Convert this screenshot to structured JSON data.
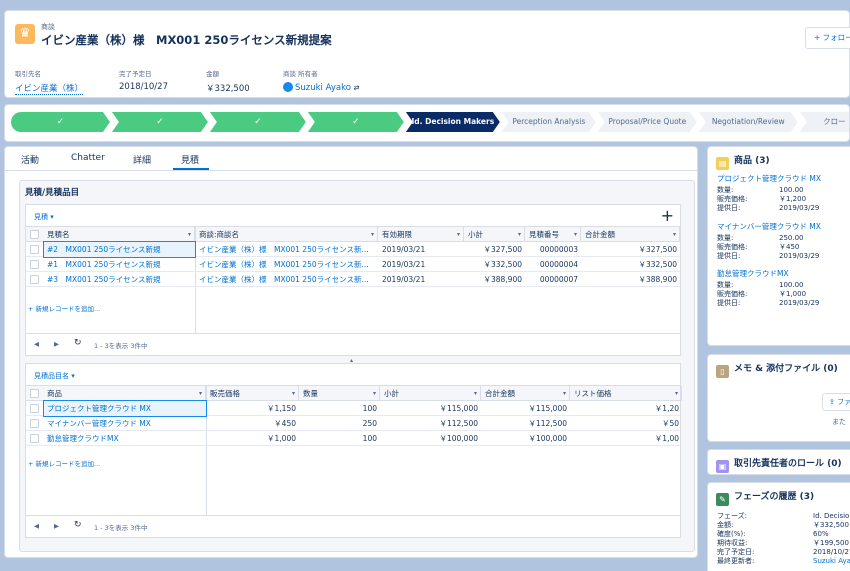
{
  "header": {
    "object_label": "商談",
    "title": "イビン産業（株）様　MX001 250ライセンス新規提案",
    "follow_label": "+ フォロー",
    "fields": [
      {
        "label": "取引先名",
        "value": "イビン産業（株）"
      },
      {
        "label": "完了予定日",
        "value": "2018/10/27"
      },
      {
        "label": "金額",
        "value": "￥332,500"
      },
      {
        "label": "商談 所有者",
        "value": "Suzuki Ayako"
      }
    ]
  },
  "path": {
    "stages": [
      {
        "label": "✓",
        "state": "done"
      },
      {
        "label": "✓",
        "state": "done"
      },
      {
        "label": "✓",
        "state": "done"
      },
      {
        "label": "✓",
        "state": "done"
      },
      {
        "label": "Id. Decision Makers",
        "state": "current"
      },
      {
        "label": "Perception Analysis",
        "state": "todo"
      },
      {
        "label": "Proposal/Price Quote",
        "state": "todo"
      },
      {
        "label": "Negotiation/Review",
        "state": "todo"
      },
      {
        "label": "クロー",
        "state": "todo"
      }
    ]
  },
  "tabs": [
    "活動",
    "Chatter",
    "詳細",
    "見積"
  ],
  "section_title": "見積/見積品目",
  "quotes_grid": {
    "view_label": "見積",
    "columns": [
      "見積名",
      "商談:商談名",
      "有効期限",
      "小計",
      "見積番号",
      "合計金額"
    ],
    "rows": [
      [
        "#2　MX001 250ライセンス新規",
        "イビン産業（株）様　MX001 250ライセンス新...",
        "2019/03/21",
        "￥327,500",
        "00000003",
        "￥327,500"
      ],
      [
        "#1　MX001 250ライセンス新規",
        "イビン産業（株）様　MX001 250ライセンス新...",
        "2019/03/21",
        "￥332,500",
        "00000004",
        "￥332,500"
      ],
      [
        "#3　MX001 250ライセンス新規",
        "イビン産業（株）様　MX001 250ライセンス新...",
        "2019/03/21",
        "￥388,900",
        "00000007",
        "￥388,900"
      ]
    ],
    "add_new": "+ 新規レコードを追加...",
    "footer": "1 - 3を表示 3件中"
  },
  "lines_grid": {
    "view_label": "見積品目名",
    "columns": [
      "商品",
      "販売価格",
      "数量",
      "小計",
      "合計金額",
      "リスト価格"
    ],
    "rows": [
      [
        "プロジェクト管理クラウド MX",
        "￥1,150",
        "100",
        "￥115,000",
        "￥115,000",
        "￥1,20"
      ],
      [
        "マイナンバー管理クラウド MX",
        "￥450",
        "250",
        "￥112,500",
        "￥112,500",
        "￥50"
      ],
      [
        "勤怠管理クラウドMX",
        "￥1,000",
        "100",
        "￥100,000",
        "￥100,000",
        "￥1,00"
      ]
    ],
    "add_new": "+ 新規レコードを追加...",
    "footer": "1 - 3を表示 3件中"
  },
  "products_card": {
    "title": "商品 (3)",
    "items": [
      {
        "name": "プロジェクト管理クラウド MX",
        "qty_label": "数量:",
        "qty": "100.00",
        "price_label": "販売価格:",
        "price": "￥1,200",
        "date_label": "提供日:",
        "date": "2019/03/29"
      },
      {
        "name": "マイナンバー管理クラウド MX",
        "qty_label": "数量:",
        "qty": "250.00",
        "price_label": "販売価格:",
        "price": "￥450",
        "date_label": "提供日:",
        "date": "2019/03/29"
      },
      {
        "name": "勤怠管理クラウドMX",
        "qty_label": "数量:",
        "qty": "100.00",
        "price_label": "販売価格:",
        "price": "￥1,000",
        "date_label": "提供日:",
        "date": "2019/03/29"
      }
    ]
  },
  "notes_card": {
    "title": "メモ & 添付ファイル (0)",
    "upload_label": "ファ",
    "drop_text": "また"
  },
  "roles_card": {
    "title": "取引先責任者のロール (0)"
  },
  "history_card": {
    "title": "フェーズの履歴 (3)",
    "rows": [
      {
        "k": "フェーズ:",
        "v": "Id. Decision"
      },
      {
        "k": "金額:",
        "v": "￥332,500"
      },
      {
        "k": "確度(%):",
        "v": "60%"
      },
      {
        "k": "期待収益:",
        "v": "￥199,500"
      },
      {
        "k": "完了予定日:",
        "v": "2018/10/27"
      },
      {
        "k": "最終更新者:",
        "v": "Suzuki Ayak"
      }
    ]
  },
  "colors": {
    "accent": "#0070d2",
    "done": "#4bca81",
    "current": "#0a2b66",
    "background": "#b0c4df"
  }
}
